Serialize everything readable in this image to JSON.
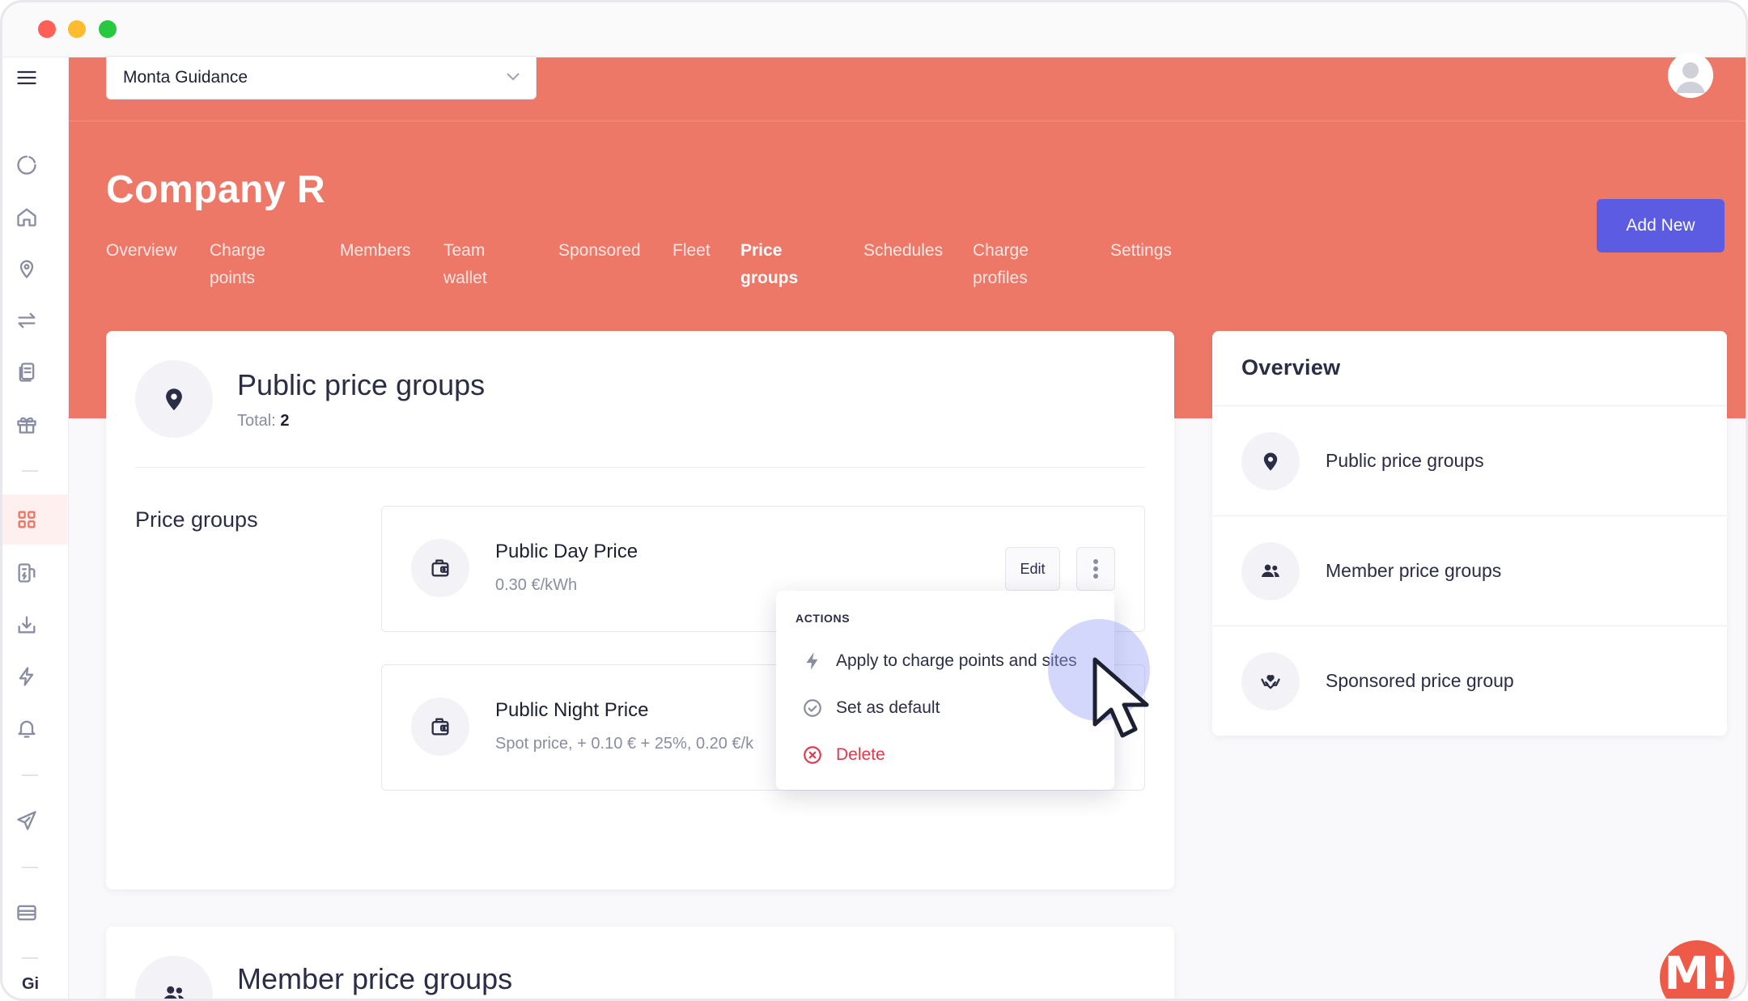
{
  "org_select": {
    "value": "Monta Guidance"
  },
  "company": {
    "name": "Company R"
  },
  "nav": [
    {
      "label": "Overview"
    },
    {
      "label": "Charge\npoints"
    },
    {
      "label": "Members"
    },
    {
      "label": "Team\nwallet"
    },
    {
      "label": "Sponsored"
    },
    {
      "label": "Fleet"
    },
    {
      "label": "Price\ngroups"
    },
    {
      "label": "Schedules"
    },
    {
      "label": "Charge\nprofiles"
    },
    {
      "label": "Settings"
    }
  ],
  "add_new_label": "Add New",
  "public_section": {
    "title": "Public price groups",
    "total_label": "Total:",
    "total_value": "2",
    "groups_label": "Price groups",
    "items": [
      {
        "name": "Public Day Price",
        "price": "0.30 €/kWh"
      },
      {
        "name": "Public Night Price",
        "price": "Spot price, + 0.10 € + 25%, 0.20 €/k"
      }
    ],
    "edit_label": "Edit"
  },
  "actions_menu": {
    "heading": "ACTIONS",
    "items": [
      {
        "label": "Apply to charge points and sites",
        "icon": "lightning-icon"
      },
      {
        "label": "Set as default",
        "icon": "check-circle-icon"
      },
      {
        "label": "Delete",
        "icon": "x-circle-icon",
        "color": "#e4374c"
      }
    ]
  },
  "member_section": {
    "title": "Member price groups"
  },
  "overview": {
    "title": "Overview",
    "items": [
      {
        "label": "Public price groups",
        "icon": "map-pin-icon"
      },
      {
        "label": "Member price groups",
        "icon": "people-icon"
      },
      {
        "label": "Sponsored price group",
        "icon": "hands-heart-icon"
      }
    ]
  },
  "sidebar_bottom_label": "Gi",
  "brand_logo_text": "M!",
  "colors": {
    "accent": "#ed7868",
    "primary_button": "#5b5ce2",
    "delete": "#e4374c"
  }
}
